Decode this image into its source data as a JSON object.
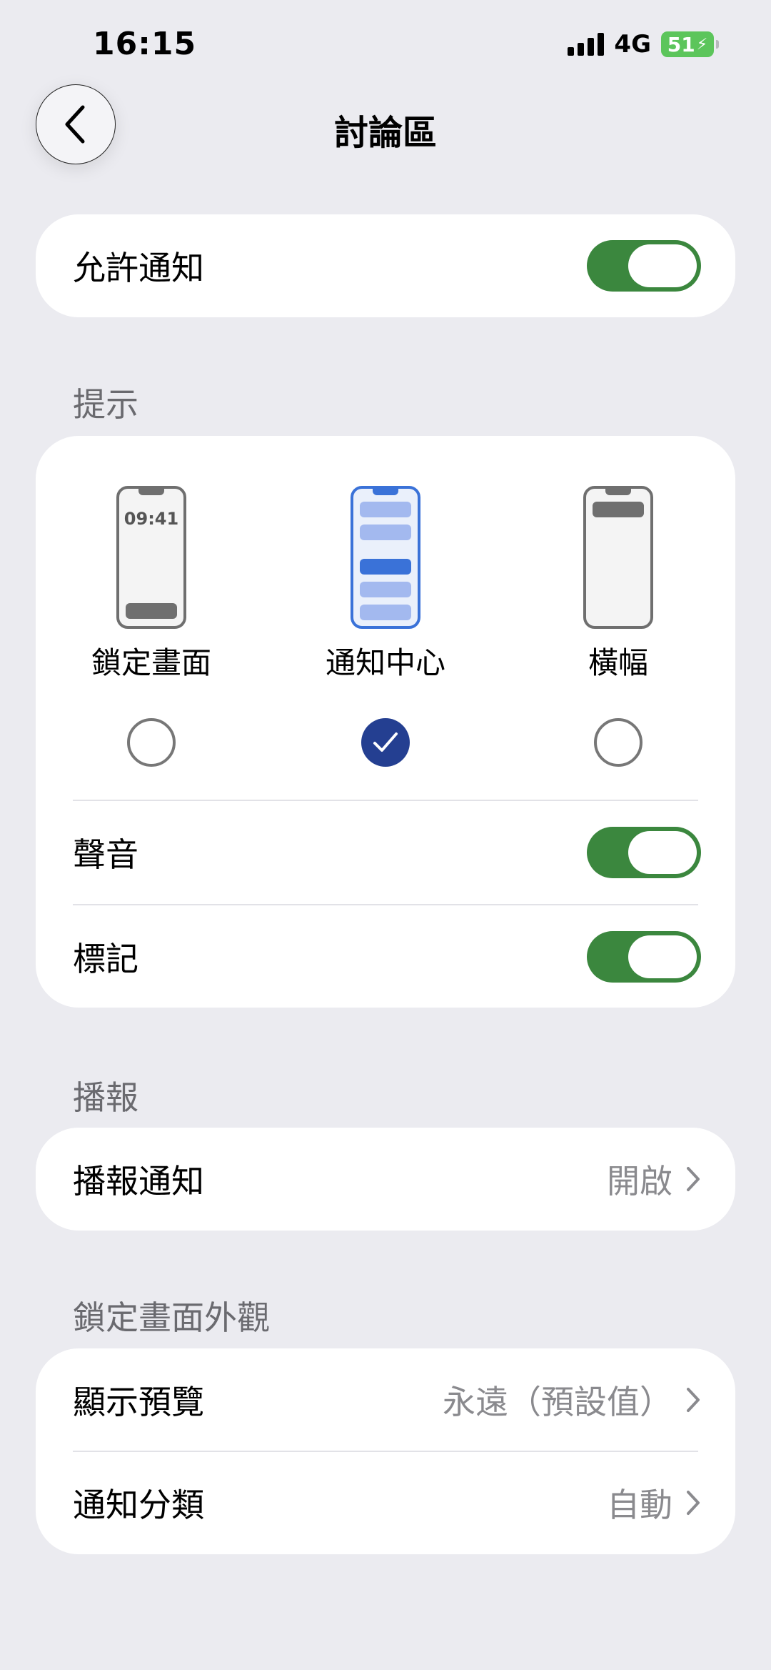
{
  "status_bar": {
    "time": "16:15",
    "network": "4G",
    "battery": "51"
  },
  "header": {
    "title": "討論區",
    "back_icon": "chevron-left-icon"
  },
  "allow_notifications": {
    "label": "允許通知",
    "enabled": true
  },
  "alerts": {
    "header": "提示",
    "options": [
      {
        "label": "鎖定畫面",
        "clock": "09:41",
        "selected": false
      },
      {
        "label": "通知中心",
        "selected": true
      },
      {
        "label": "橫幅",
        "selected": false
      }
    ],
    "sounds": {
      "label": "聲音",
      "enabled": true
    },
    "badges": {
      "label": "標記",
      "enabled": true
    }
  },
  "announce": {
    "header": "播報",
    "row": {
      "label": "播報通知",
      "value": "開啟"
    }
  },
  "lock_screen": {
    "header": "鎖定畫面外觀",
    "rows": [
      {
        "label": "顯示預覽",
        "value": "永遠（預設值）"
      },
      {
        "label": "通知分類",
        "value": "自動"
      }
    ]
  },
  "colors": {
    "toggle_on": "#3b873e",
    "radio_checked": "#243f91",
    "accent_blue": "#3a72d8"
  }
}
